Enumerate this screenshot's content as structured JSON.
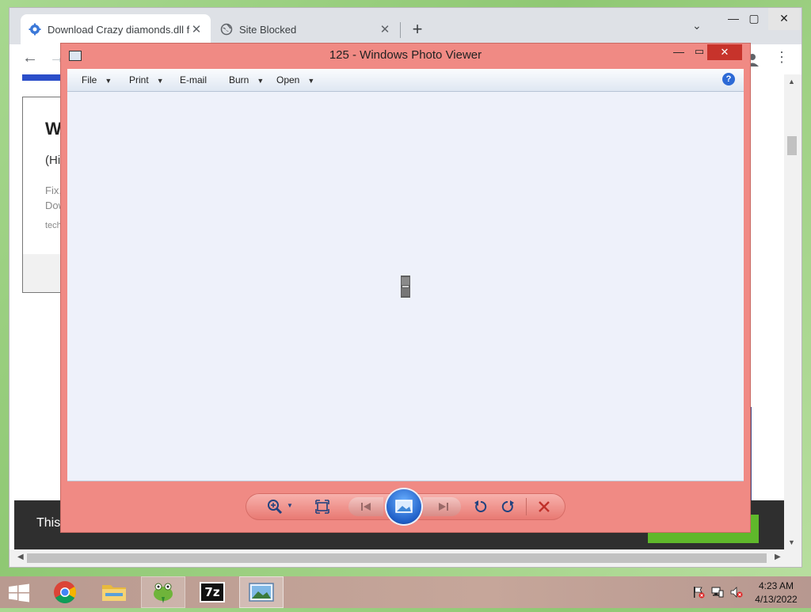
{
  "browser": {
    "tabs": [
      {
        "title": "Download Crazy diamonds.dll fo",
        "icon": "puzzle-gear-icon",
        "active": true
      },
      {
        "title": "Site Blocked",
        "icon": "globe-icon",
        "active": false
      }
    ],
    "new_tab_label": "+",
    "page": {
      "card_title": "Wir",
      "card_subtitle": "(High",
      "card_desc_line1": "Fix, C",
      "card_desc_line2": "Down",
      "card_domain": "techic",
      "cookie_text": "This"
    }
  },
  "photo_viewer": {
    "title": "125 - Windows Photo Viewer",
    "menu": [
      "File",
      "Print",
      "E-mail",
      "Burn",
      "Open"
    ],
    "help_label": "?",
    "controls": [
      "zoom",
      "actual-size",
      "previous",
      "slide-show",
      "next",
      "rotate-counterclockwise",
      "rotate-clockwise",
      "delete"
    ]
  },
  "taskbar": {
    "apps": [
      "chrome",
      "file-explorer",
      "frog-app",
      "7-zip",
      "photo-viewer"
    ],
    "seven_zip_label": "7z",
    "time": "4:23 AM",
    "date": "4/13/2022"
  },
  "colors": {
    "viewer_frame": "#f08a84",
    "close_button": "#c7332b",
    "canvas": "#eef1fa",
    "taskbar": "#c6a69a",
    "chrome_tabstrip": "#dee1e6"
  }
}
